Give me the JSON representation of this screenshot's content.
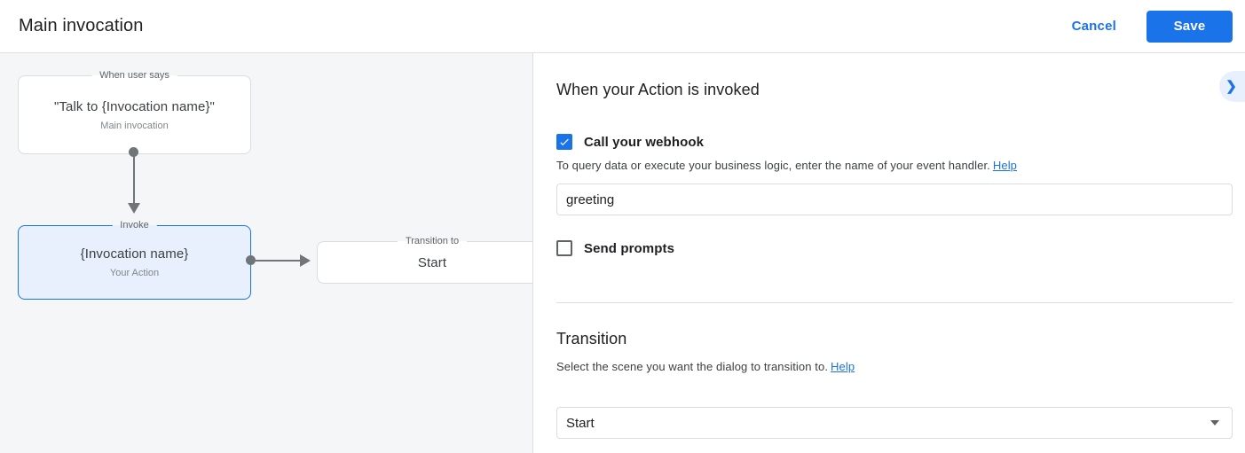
{
  "topbar": {
    "title": "Main invocation",
    "cancel_label": "Cancel",
    "save_label": "Save"
  },
  "canvas": {
    "nodes": [
      {
        "legend": "When user says",
        "title": "\"Talk to {Invocation name}\"",
        "subtitle": "Main invocation"
      },
      {
        "legend": "Invoke",
        "title": "{Invocation name}",
        "subtitle": "Your Action"
      },
      {
        "legend": "Transition to",
        "title": "Start"
      }
    ]
  },
  "panel": {
    "invocation": {
      "heading": "When your Action is invoked",
      "webhook_checkbox_label": "Call your webhook",
      "webhook_checked": true,
      "webhook_help_text": "To query data or execute your business logic, enter the name of your event handler.",
      "webhook_help_link": "Help",
      "handler_value": "greeting",
      "prompts_checkbox_label": "Send prompts",
      "prompts_checked": false
    },
    "transition": {
      "heading": "Transition",
      "help_text": "Select the scene you want the dialog to transition to.",
      "help_link": "Help",
      "selected_scene": "Start"
    }
  },
  "colors": {
    "accent": "#1a73e8",
    "selected_node_bg": "#e8f0fe",
    "selected_node_border": "#1a73e8",
    "canvas_bg": "#f5f6f8",
    "link": "#1a73e8"
  }
}
